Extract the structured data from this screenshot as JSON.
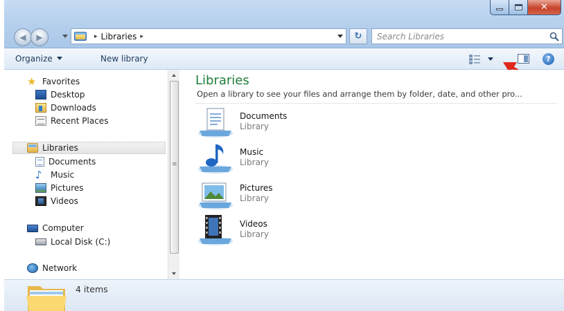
{
  "window": {
    "caption_buttons": [
      "minimize",
      "maximize",
      "close"
    ],
    "close_glyph": "✕"
  },
  "address": {
    "breadcrumb": [
      "Libraries"
    ],
    "separator": "▸",
    "refresh_glyph": "↻"
  },
  "search": {
    "placeholder": "Search Libraries"
  },
  "commandbar": {
    "organize_label": "Organize",
    "new_library_label": "New library",
    "help_glyph": "?"
  },
  "annotation": {
    "arrow_color": "#e0281c"
  },
  "navpane": {
    "favorites_label": "Favorites",
    "favorites": [
      {
        "label": "Desktop",
        "icon": "desktop-icon"
      },
      {
        "label": "Downloads",
        "icon": "downloads-icon"
      },
      {
        "label": "Recent Places",
        "icon": "recent-places-icon"
      }
    ],
    "libraries_label": "Libraries",
    "libraries": [
      {
        "label": "Documents",
        "icon": "documents-icon"
      },
      {
        "label": "Music",
        "icon": "music-icon"
      },
      {
        "label": "Pictures",
        "icon": "pictures-icon"
      },
      {
        "label": "Videos",
        "icon": "videos-icon"
      }
    ],
    "computer_label": "Computer",
    "computer": [
      {
        "label": "Local Disk (C:)",
        "icon": "disk-icon"
      }
    ],
    "network_label": "Network"
  },
  "content": {
    "title": "Libraries",
    "description": "Open a library to see your files and arrange them by folder, date, and other pro...",
    "title_color": "#1e7d3a",
    "items": [
      {
        "name": "Documents",
        "type": "Library",
        "icon": "documents-library-icon"
      },
      {
        "name": "Music",
        "type": "Library",
        "icon": "music-library-icon"
      },
      {
        "name": "Pictures",
        "type": "Library",
        "icon": "pictures-library-icon"
      },
      {
        "name": "Videos",
        "type": "Library",
        "icon": "videos-library-icon"
      }
    ]
  },
  "details": {
    "count_text": "4 items"
  }
}
